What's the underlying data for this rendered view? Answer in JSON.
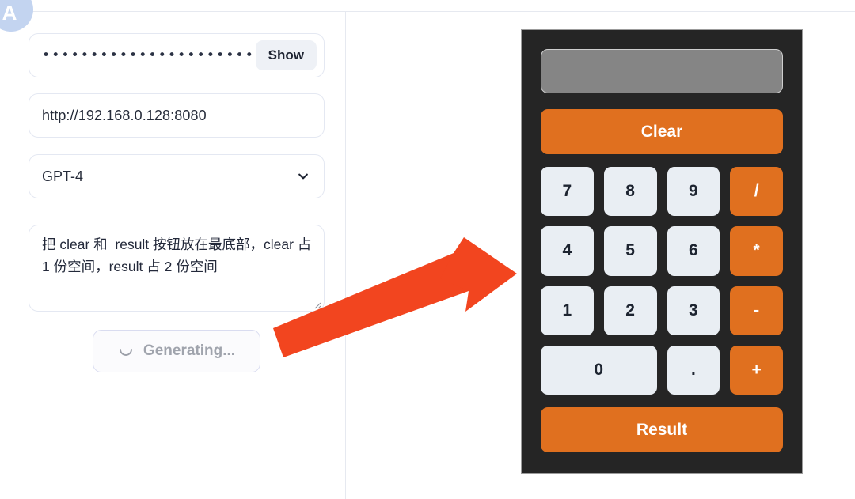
{
  "app": {
    "avatar_letter": "A",
    "accent_orange": "#e0701f",
    "arrow_color": "#f2451f",
    "calculator_body": "#252525",
    "key_light": "#e9eef3",
    "display_gray": "#858585"
  },
  "left_panel": {
    "password_field": {
      "masked_value": "••••••••••••••••••••••••••••",
      "show_button_label": "Show"
    },
    "url_field": {
      "value": "http://192.168.0.128:8080",
      "placeholder": "http://192.168.0.128:8080"
    },
    "model_select": {
      "value": "GPT-4",
      "options": [
        "GPT-4"
      ],
      "chevron_icon": "chevron-down-icon"
    },
    "prompt_textarea": {
      "value": "把 clear 和  result 按钮放在最底部，clear 占 1 份空间，result 占 2 份空间",
      "placeholder": ""
    },
    "generate_button": {
      "label": "Generating...",
      "icon": "spinner-icon",
      "state": "loading"
    }
  },
  "calculator": {
    "display_value": "",
    "clear_label": "Clear",
    "result_label": "Result",
    "keys": [
      {
        "label": "7",
        "kind": "num",
        "span": 1
      },
      {
        "label": "8",
        "kind": "num",
        "span": 1
      },
      {
        "label": "9",
        "kind": "num",
        "span": 1
      },
      {
        "label": "/",
        "kind": "op",
        "span": 1
      },
      {
        "label": "4",
        "kind": "num",
        "span": 1
      },
      {
        "label": "5",
        "kind": "num",
        "span": 1
      },
      {
        "label": "6",
        "kind": "num",
        "span": 1
      },
      {
        "label": "*",
        "kind": "op",
        "span": 1
      },
      {
        "label": "1",
        "kind": "num",
        "span": 1
      },
      {
        "label": "2",
        "kind": "num",
        "span": 1
      },
      {
        "label": "3",
        "kind": "num",
        "span": 1
      },
      {
        "label": "-",
        "kind": "op",
        "span": 1
      },
      {
        "label": "0",
        "kind": "num",
        "span": 2
      },
      {
        "label": ".",
        "kind": "num",
        "span": 1
      },
      {
        "label": "+",
        "kind": "op",
        "span": 1
      }
    ]
  },
  "annotation": {
    "arrow": "red-arrow-pointing-to-calculator"
  }
}
